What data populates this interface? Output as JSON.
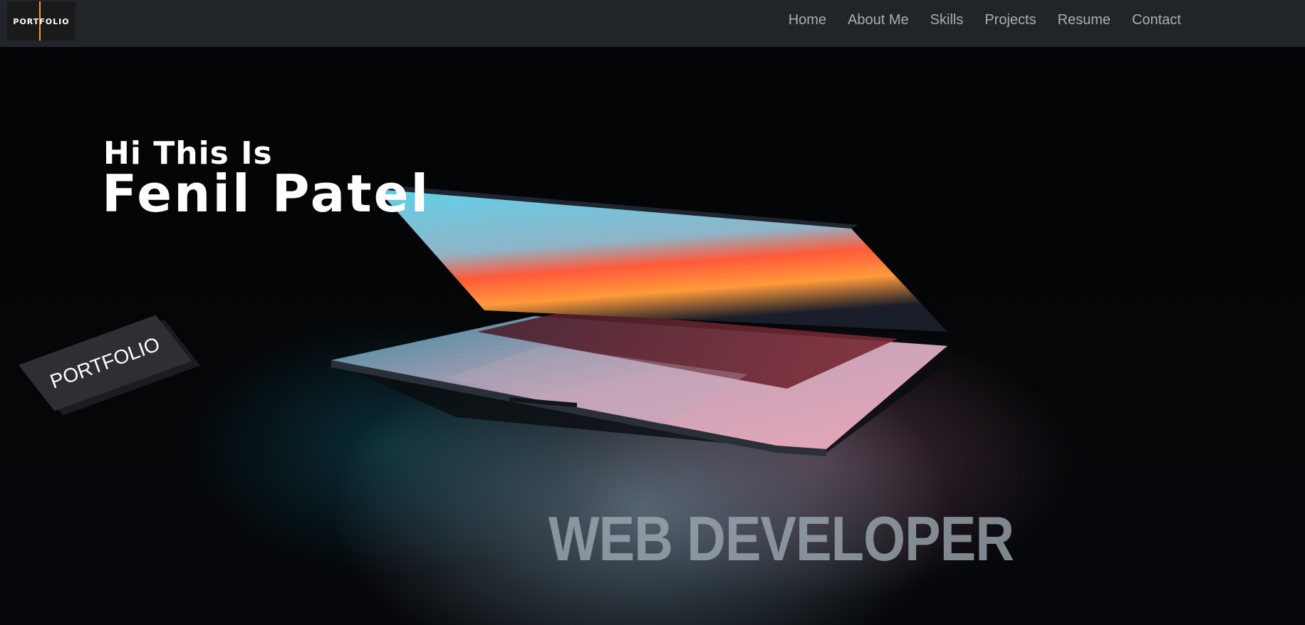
{
  "navbar": {
    "logo_text": "PORTFOLIO",
    "links": [
      {
        "label": "Home"
      },
      {
        "label": "About Me"
      },
      {
        "label": "Skills"
      },
      {
        "label": "Projects"
      },
      {
        "label": "Resume"
      },
      {
        "label": "Contact"
      }
    ]
  },
  "hero": {
    "greeting": "Hi This Is",
    "name": "Fenil Patel",
    "badge": "PORTFOLIO",
    "role": "WEB DEVELOPER"
  },
  "colors": {
    "navbar_bg": "#212529",
    "logo_accent": "#ff9a1f",
    "background": "#000000"
  }
}
